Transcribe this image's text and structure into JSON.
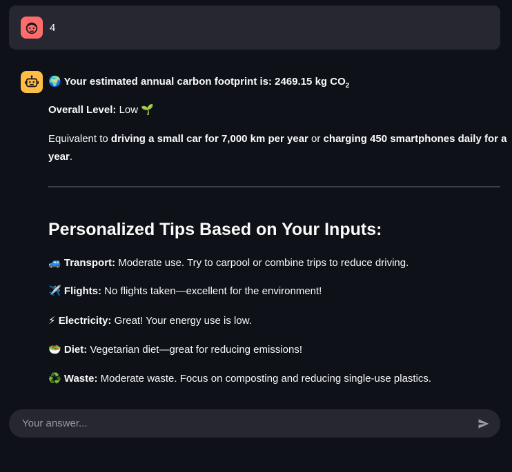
{
  "user_message": {
    "text": "4",
    "avatar_color": "#ff6c6c"
  },
  "assistant_message": {
    "avatar_color": "#ffbd45",
    "footprint": {
      "emoji": "🌍",
      "label": "Your estimated annual carbon footprint is: 2469.15 kg CO",
      "subscript": "2"
    },
    "overall_level": {
      "label": "Overall Level:",
      "value": "Low",
      "emoji": "🌱"
    },
    "equivalent": {
      "prefix": "Equivalent to ",
      "part1": "driving a small car for 7,000 km per year",
      "middle": " or ",
      "part2_line1": "charging 450 smartphones daily for a",
      "part2_line2": "year",
      "suffix": "."
    },
    "heading": "Personalized Tips Based on Your Inputs:",
    "tips": [
      {
        "emoji": "🚙",
        "label": "Transport:",
        "text": " Moderate use. Try to carpool or combine trips to reduce driving."
      },
      {
        "emoji": "✈️",
        "label": "Flights:",
        "text": " No flights taken—excellent for the environment!"
      },
      {
        "emoji": "⚡",
        "label": "Electricity:",
        "text": " Great! Your energy use is low."
      },
      {
        "emoji": "🥗",
        "label": "Diet:",
        "text": " Vegetarian diet—great for reducing emissions!"
      },
      {
        "emoji": "♻️",
        "label": "Waste:",
        "text": " Moderate waste. Focus on composting and reducing single-use plastics."
      }
    ]
  },
  "chat_input": {
    "placeholder": "Your answer..."
  }
}
